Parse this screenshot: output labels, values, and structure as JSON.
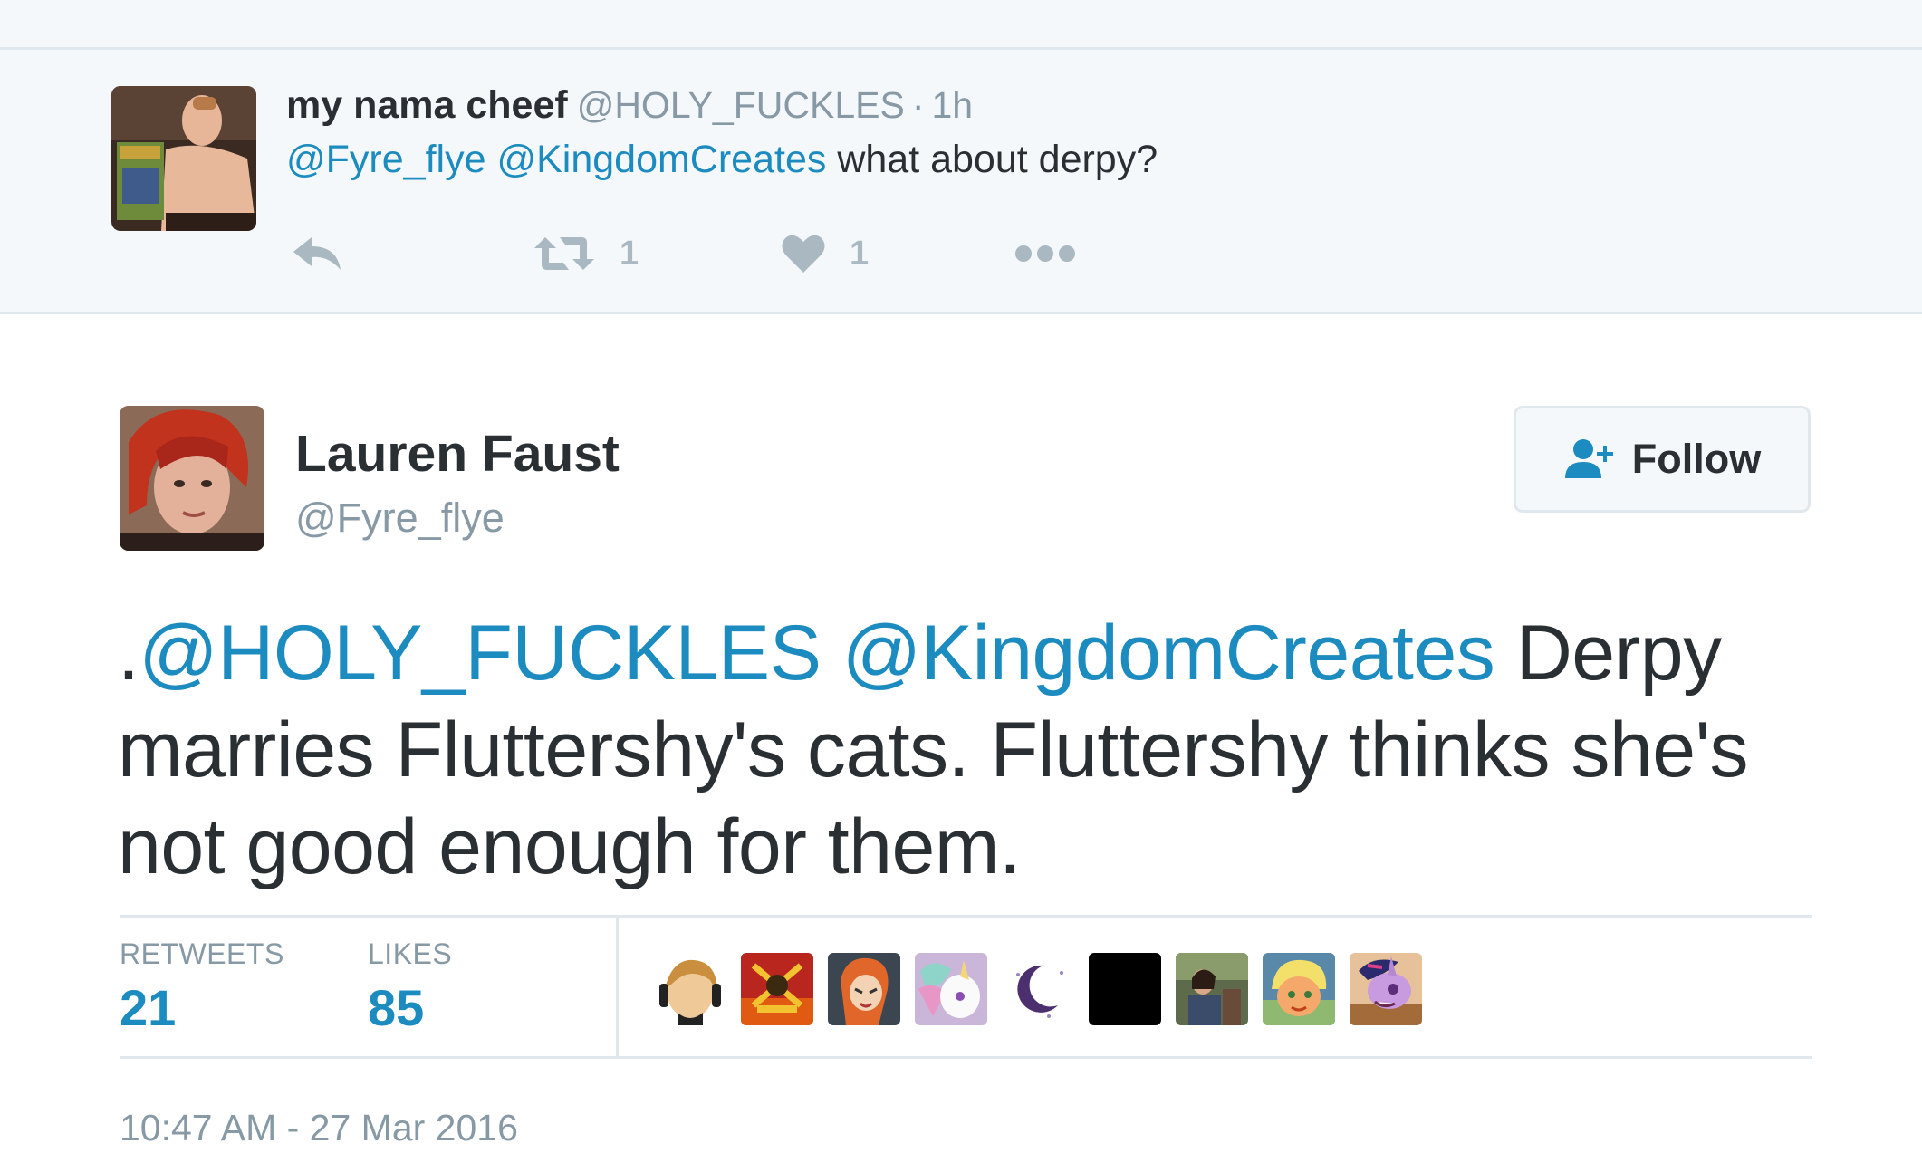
{
  "reply": {
    "name": "my nama cheef",
    "handle": "@HOLY_FUCKLES",
    "separator": "·",
    "time": "1h",
    "mentions": [
      "@Fyre_flye",
      "@KingdomCreates"
    ],
    "text": "what about derpy?",
    "retweet_count": "1",
    "like_count": "1"
  },
  "tweet": {
    "name": "Lauren Faust",
    "handle": "@Fyre_flye",
    "follow_label": "Follow",
    "text_prefix": ".",
    "mentions": [
      "@HOLY_FUCKLES",
      "@KingdomCreates"
    ],
    "text_line1_tail": "Derpy",
    "text_rest": "marries Fluttershy's cats. Fluttershy thinks she's not good enough for them.",
    "stats": {
      "retweets_label": "RETWEETS",
      "retweets": "21",
      "likes_label": "LIKES",
      "likes": "85"
    },
    "timestamp": "10:47 AM - 27 Mar 2016"
  },
  "icons": [
    "reply-icon",
    "retweet-icon",
    "heart-icon",
    "more-icon",
    "follow-user-icon"
  ],
  "colors": {
    "link": "#1c8bc0",
    "muted": "#8899a6",
    "action_gray": "#aab8c2",
    "reply_bg": "#f5f8fa",
    "divider": "#e1e8ed"
  }
}
